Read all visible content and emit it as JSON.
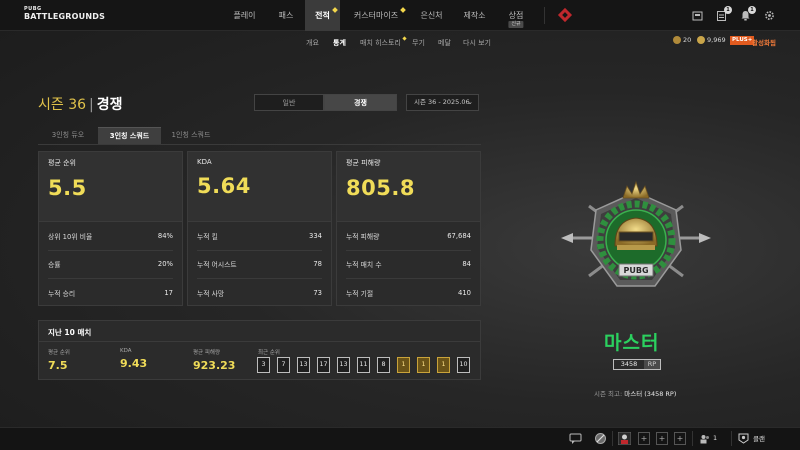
{
  "logo": {
    "line1": "PUBG",
    "line2": "BATTLEGROUNDS"
  },
  "nav": {
    "items": [
      "플레이",
      "패스",
      "전적",
      "커스터마이즈",
      "은신처",
      "제작소",
      "상점"
    ],
    "shop_tag": "신규"
  },
  "top_icons": [
    {
      "name": "inventory-icon"
    },
    {
      "name": "mission-icon",
      "badge": "1"
    },
    {
      "name": "notification-icon",
      "badge": "1"
    },
    {
      "name": "settings-icon"
    }
  ],
  "subnav": [
    "개요",
    "통계",
    "매치 히스토리",
    "무기",
    "메달",
    "다시 보기"
  ],
  "currency": {
    "coins": "20",
    "bp": "9,969"
  },
  "plus": {
    "badge": "PLUS+",
    "label": "활성화됨"
  },
  "season": {
    "number": "시즌 36",
    "mode": "경쟁"
  },
  "segment": {
    "normal": "일반",
    "ranked": "경쟁"
  },
  "season_dropdown": "시즌 36 - 2025.06",
  "mode_tabs": [
    "3인칭 듀오",
    "3인칭 스쿼드",
    "1인칭 스쿼드"
  ],
  "cards": [
    {
      "label": "평균 순위",
      "value": "5.5",
      "rows": [
        [
          "상위 10위 비율",
          "84%"
        ],
        [
          "승률",
          "20%"
        ],
        [
          "누적 승리",
          "17"
        ]
      ]
    },
    {
      "label": "KDA",
      "value": "5.64",
      "rows": [
        [
          "누적 킬",
          "334"
        ],
        [
          "누적 어시스트",
          "78"
        ],
        [
          "누적 사망",
          "73"
        ]
      ]
    },
    {
      "label": "평균 피해량",
      "value": "805.8",
      "rows": [
        [
          "누적 피해량",
          "67,684"
        ],
        [
          "누적 매치 수",
          "84"
        ],
        [
          "누적 기절",
          "410"
        ]
      ]
    }
  ],
  "recent": {
    "title": "지난 10 매치",
    "stats": [
      [
        "평균 순위",
        "7.5"
      ],
      [
        "KDA",
        "9.43"
      ],
      [
        "평균 피해량",
        "923.23"
      ]
    ],
    "ranks_label": "최근 순위",
    "ranks": [
      "3",
      "7",
      "13",
      "17",
      "13",
      "11",
      "8",
      "1",
      "1",
      "1",
      "10"
    ]
  },
  "tier": {
    "name": "마스터",
    "rp": "3458",
    "rp_unit": "RP",
    "best_label": "시즌 최고:",
    "best_value": "마스터 (3458 RP)",
    "emblem_text": "PUBG"
  },
  "bottom": {
    "party_count": "1",
    "clan": "클랜"
  },
  "colors": {
    "accent": "#f0dc58",
    "tier": "#2bd15f",
    "plus": "#e25b1f"
  }
}
